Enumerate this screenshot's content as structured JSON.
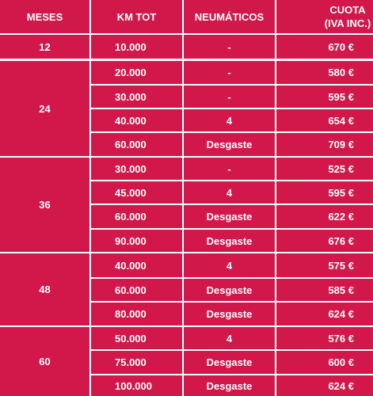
{
  "headers": {
    "meses": "MESES",
    "km": "KM TOT",
    "neumaticos": "NEUMÁTICOS",
    "cuota": "CUOTA (IVA INC.)"
  },
  "groups": [
    {
      "meses": "12",
      "rows": [
        {
          "km": "10.000",
          "neumaticos": "-",
          "cuota": "670 €"
        }
      ]
    },
    {
      "meses": "24",
      "rows": [
        {
          "km": "20.000",
          "neumaticos": "-",
          "cuota": "580 €"
        },
        {
          "km": "30.000",
          "neumaticos": "-",
          "cuota": "595 €"
        },
        {
          "km": "40.000",
          "neumaticos": "4",
          "cuota": "654 €"
        },
        {
          "km": "60.000",
          "neumaticos": "Desgaste",
          "cuota": "709 €"
        }
      ]
    },
    {
      "meses": "36",
      "rows": [
        {
          "km": "30.000",
          "neumaticos": "-",
          "cuota": "525 €"
        },
        {
          "km": "45.000",
          "neumaticos": "4",
          "cuota": "595 €"
        },
        {
          "km": "60.000",
          "neumaticos": "Desgaste",
          "cuota": "622 €"
        },
        {
          "km": "90.000",
          "neumaticos": "Desgaste",
          "cuota": "676 €"
        }
      ]
    },
    {
      "meses": "48",
      "rows": [
        {
          "km": "40.000",
          "neumaticos": "4",
          "cuota": "575 €"
        },
        {
          "km": "60.000",
          "neumaticos": "Desgaste",
          "cuota": "585 €"
        },
        {
          "km": "80.000",
          "neumaticos": "Desgaste",
          "cuota": "624 €"
        }
      ]
    },
    {
      "meses": "60",
      "rows": [
        {
          "km": "50.000",
          "neumaticos": "4",
          "cuota": "576 €"
        },
        {
          "km": "75.000",
          "neumaticos": "Desgaste",
          "cuota": "600 €"
        },
        {
          "km": "100.000",
          "neumaticos": "Desgaste",
          "cuota": "624 €"
        }
      ]
    }
  ]
}
